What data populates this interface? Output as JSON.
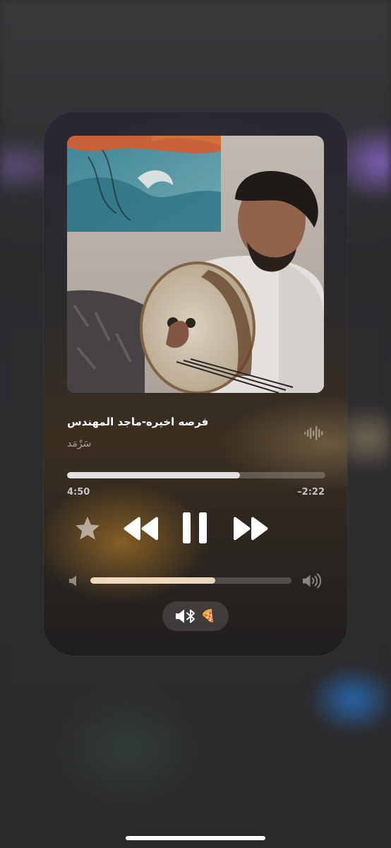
{
  "now_playing": {
    "title": "فرصه اخيره-ماجد المهندس",
    "artist": "سَرْمَد",
    "progress_fraction": 0.67,
    "elapsed": "4:50",
    "remaining": "–2:22"
  },
  "controls": {
    "star_icon": "star-icon",
    "rewind_icon": "rewind-icon",
    "pause_icon": "pause-icon",
    "forward_icon": "fast-forward-icon"
  },
  "volume": {
    "level_fraction": 0.62,
    "low_icon": "speaker-low-icon",
    "high_icon": "speaker-high-icon"
  },
  "output_route": {
    "icon": "speaker-bluetooth-icon",
    "emoji": "🍕"
  },
  "colors": {
    "accent_glow": "#cd8c28",
    "text_primary": "#ffffff"
  }
}
